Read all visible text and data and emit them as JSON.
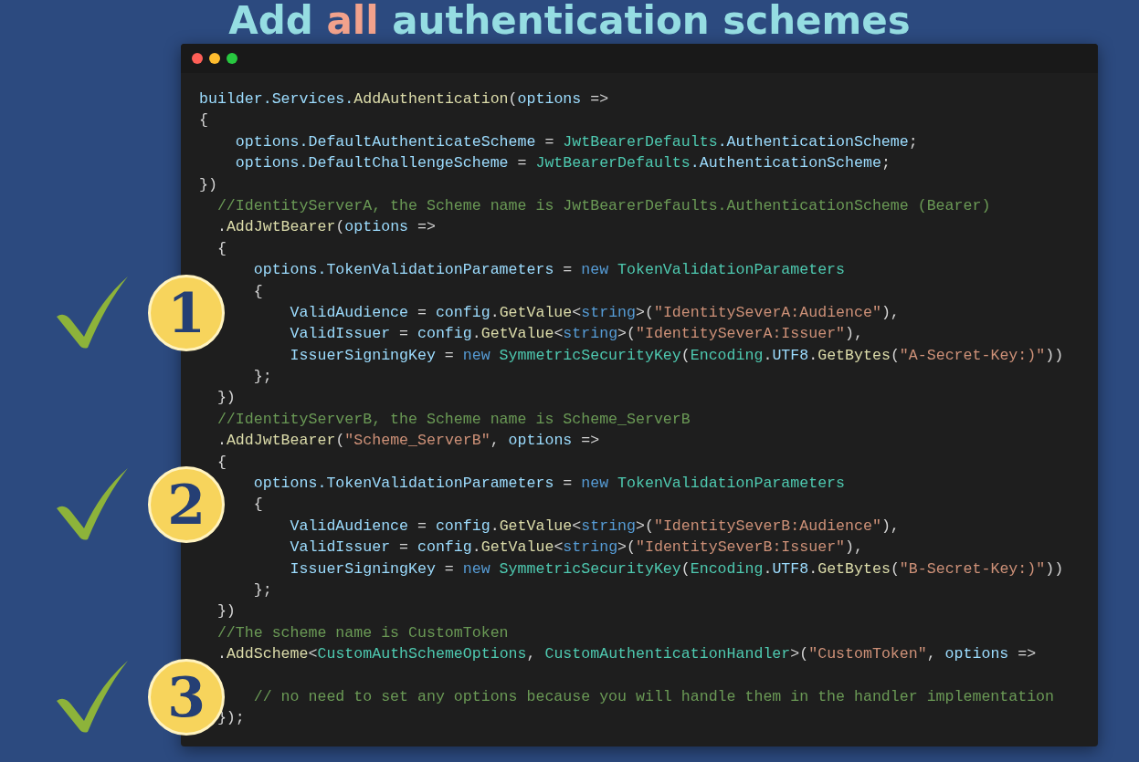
{
  "title": [
    {
      "text": "Add ",
      "kind": "main"
    },
    {
      "text": "all",
      "kind": "accent"
    },
    {
      "text": " authentication schemes",
      "kind": "main"
    }
  ],
  "code_lines": [
    [
      {
        "kind": "var",
        "text": "builder.Services."
      },
      {
        "kind": "method",
        "text": "AddAuthentication"
      },
      {
        "kind": "plain",
        "text": "("
      },
      {
        "kind": "var",
        "text": "options"
      },
      {
        "kind": "plain",
        "text": " =>"
      }
    ],
    [
      {
        "kind": "plain",
        "text": "{"
      }
    ],
    [
      {
        "kind": "var",
        "text": "    options.DefaultAuthenticateScheme"
      },
      {
        "kind": "plain",
        "text": " = "
      },
      {
        "kind": "type",
        "text": "JwtBearerDefaults"
      },
      {
        "kind": "var",
        "text": ".AuthenticationScheme"
      },
      {
        "kind": "plain",
        "text": ";"
      }
    ],
    [
      {
        "kind": "var",
        "text": "    options.DefaultChallengeScheme"
      },
      {
        "kind": "plain",
        "text": " = "
      },
      {
        "kind": "type",
        "text": "JwtBearerDefaults"
      },
      {
        "kind": "var",
        "text": ".AuthenticationScheme"
      },
      {
        "kind": "plain",
        "text": ";"
      }
    ],
    [
      {
        "kind": "plain",
        "text": "})"
      }
    ],
    [
      {
        "kind": "comment",
        "text": "  //IdentityServerA, the Scheme name is JwtBearerDefaults.AuthenticationScheme (Bearer)"
      }
    ],
    [
      {
        "kind": "plain",
        "text": "  ."
      },
      {
        "kind": "method",
        "text": "AddJwtBearer"
      },
      {
        "kind": "plain",
        "text": "("
      },
      {
        "kind": "var",
        "text": "options"
      },
      {
        "kind": "plain",
        "text": " =>"
      }
    ],
    [
      {
        "kind": "plain",
        "text": "  {"
      }
    ],
    [
      {
        "kind": "var",
        "text": "      options.TokenValidationParameters"
      },
      {
        "kind": "plain",
        "text": " = "
      },
      {
        "kind": "keyword",
        "text": "new"
      },
      {
        "kind": "type",
        "text": " TokenValidationParameters"
      }
    ],
    [
      {
        "kind": "plain",
        "text": "      {"
      }
    ],
    [
      {
        "kind": "var",
        "text": "          ValidAudience"
      },
      {
        "kind": "plain",
        "text": " = "
      },
      {
        "kind": "var",
        "text": "config"
      },
      {
        "kind": "plain",
        "text": "."
      },
      {
        "kind": "method",
        "text": "GetValue"
      },
      {
        "kind": "plain",
        "text": "<"
      },
      {
        "kind": "keyword",
        "text": "string"
      },
      {
        "kind": "plain",
        "text": ">("
      },
      {
        "kind": "string",
        "text": "\"IdentitySeverA:Audience\""
      },
      {
        "kind": "plain",
        "text": "),"
      }
    ],
    [
      {
        "kind": "var",
        "text": "          ValidIssuer"
      },
      {
        "kind": "plain",
        "text": " = "
      },
      {
        "kind": "var",
        "text": "config"
      },
      {
        "kind": "plain",
        "text": "."
      },
      {
        "kind": "method",
        "text": "GetValue"
      },
      {
        "kind": "plain",
        "text": "<"
      },
      {
        "kind": "keyword",
        "text": "string"
      },
      {
        "kind": "plain",
        "text": ">("
      },
      {
        "kind": "string",
        "text": "\"IdentitySeverA:Issuer\""
      },
      {
        "kind": "plain",
        "text": "),"
      }
    ],
    [
      {
        "kind": "var",
        "text": "          IssuerSigningKey"
      },
      {
        "kind": "plain",
        "text": " = "
      },
      {
        "kind": "keyword",
        "text": "new"
      },
      {
        "kind": "type",
        "text": " SymmetricSecurityKey"
      },
      {
        "kind": "plain",
        "text": "("
      },
      {
        "kind": "type",
        "text": "Encoding"
      },
      {
        "kind": "plain",
        "text": "."
      },
      {
        "kind": "var",
        "text": "UTF8"
      },
      {
        "kind": "plain",
        "text": "."
      },
      {
        "kind": "method",
        "text": "GetBytes"
      },
      {
        "kind": "plain",
        "text": "("
      },
      {
        "kind": "string",
        "text": "\"A-Secret-Key:)\""
      },
      {
        "kind": "plain",
        "text": "))"
      }
    ],
    [
      {
        "kind": "plain",
        "text": "      };"
      }
    ],
    [
      {
        "kind": "plain",
        "text": "  })"
      }
    ],
    [
      {
        "kind": "comment",
        "text": "  //IdentityServerB, the Scheme name is Scheme_ServerB"
      }
    ],
    [
      {
        "kind": "plain",
        "text": "  ."
      },
      {
        "kind": "method",
        "text": "AddJwtBearer"
      },
      {
        "kind": "plain",
        "text": "("
      },
      {
        "kind": "string",
        "text": "\"Scheme_ServerB\""
      },
      {
        "kind": "plain",
        "text": ", "
      },
      {
        "kind": "var",
        "text": "options"
      },
      {
        "kind": "plain",
        "text": " =>"
      }
    ],
    [
      {
        "kind": "plain",
        "text": "  {"
      }
    ],
    [
      {
        "kind": "var",
        "text": "      options.TokenValidationParameters"
      },
      {
        "kind": "plain",
        "text": " = "
      },
      {
        "kind": "keyword",
        "text": "new"
      },
      {
        "kind": "type",
        "text": " TokenValidationParameters"
      }
    ],
    [
      {
        "kind": "plain",
        "text": "      {"
      }
    ],
    [
      {
        "kind": "var",
        "text": "          ValidAudience"
      },
      {
        "kind": "plain",
        "text": " = "
      },
      {
        "kind": "var",
        "text": "config"
      },
      {
        "kind": "plain",
        "text": "."
      },
      {
        "kind": "method",
        "text": "GetValue"
      },
      {
        "kind": "plain",
        "text": "<"
      },
      {
        "kind": "keyword",
        "text": "string"
      },
      {
        "kind": "plain",
        "text": ">("
      },
      {
        "kind": "string",
        "text": "\"IdentitySeverB:Audience\""
      },
      {
        "kind": "plain",
        "text": "),"
      }
    ],
    [
      {
        "kind": "var",
        "text": "          ValidIssuer"
      },
      {
        "kind": "plain",
        "text": " = "
      },
      {
        "kind": "var",
        "text": "config"
      },
      {
        "kind": "plain",
        "text": "."
      },
      {
        "kind": "method",
        "text": "GetValue"
      },
      {
        "kind": "plain",
        "text": "<"
      },
      {
        "kind": "keyword",
        "text": "string"
      },
      {
        "kind": "plain",
        "text": ">("
      },
      {
        "kind": "string",
        "text": "\"IdentitySeverB:Issuer\""
      },
      {
        "kind": "plain",
        "text": "),"
      }
    ],
    [
      {
        "kind": "var",
        "text": "          IssuerSigningKey"
      },
      {
        "kind": "plain",
        "text": " = "
      },
      {
        "kind": "keyword",
        "text": "new"
      },
      {
        "kind": "type",
        "text": " SymmetricSecurityKey"
      },
      {
        "kind": "plain",
        "text": "("
      },
      {
        "kind": "type",
        "text": "Encoding"
      },
      {
        "kind": "plain",
        "text": "."
      },
      {
        "kind": "var",
        "text": "UTF8"
      },
      {
        "kind": "plain",
        "text": "."
      },
      {
        "kind": "method",
        "text": "GetBytes"
      },
      {
        "kind": "plain",
        "text": "("
      },
      {
        "kind": "string",
        "text": "\"B-Secret-Key:)\""
      },
      {
        "kind": "plain",
        "text": "))"
      }
    ],
    [
      {
        "kind": "plain",
        "text": "      };"
      }
    ],
    [
      {
        "kind": "plain",
        "text": "  })"
      }
    ],
    [
      {
        "kind": "comment",
        "text": "  //The scheme name is CustomToken"
      }
    ],
    [
      {
        "kind": "plain",
        "text": "  ."
      },
      {
        "kind": "method",
        "text": "AddScheme"
      },
      {
        "kind": "plain",
        "text": "<"
      },
      {
        "kind": "type",
        "text": "CustomAuthSchemeOptions"
      },
      {
        "kind": "plain",
        "text": ", "
      },
      {
        "kind": "type",
        "text": "CustomAuthenticationHandler"
      },
      {
        "kind": "plain",
        "text": ">("
      },
      {
        "kind": "string",
        "text": "\"CustomToken\""
      },
      {
        "kind": "plain",
        "text": ", "
      },
      {
        "kind": "var",
        "text": "options"
      },
      {
        "kind": "plain",
        "text": " =>"
      }
    ],
    [
      {
        "kind": "comment",
        "text": "      // no need to set any options because you will handle them in the handler implementation"
      }
    ],
    [
      {
        "kind": "plain",
        "text": "  });"
      }
    ]
  ],
  "steps": [
    {
      "number": "1"
    },
    {
      "number": "2"
    },
    {
      "number": "3"
    }
  ]
}
